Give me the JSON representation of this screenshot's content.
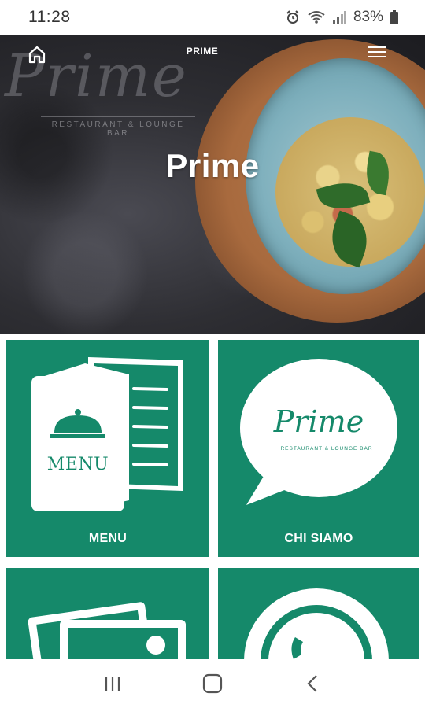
{
  "status_bar": {
    "time": "11:28",
    "battery": "83%"
  },
  "header": {
    "nav_title": "PRIME",
    "hero_title": "Prime",
    "brand_script": "Prime",
    "brand_sub": "RESTAURANT & LOUNGE BAR"
  },
  "tiles": [
    {
      "label": "MENU",
      "icon_text": "MENU"
    },
    {
      "label": "CHI SIAMO",
      "logo_script": "Prime",
      "logo_sub": "RESTAURANT & LOUNGE BAR"
    },
    {
      "label": ""
    },
    {
      "label": ""
    }
  ],
  "colors": {
    "accent": "#15896a",
    "hero_bg": "#2e2e33"
  }
}
